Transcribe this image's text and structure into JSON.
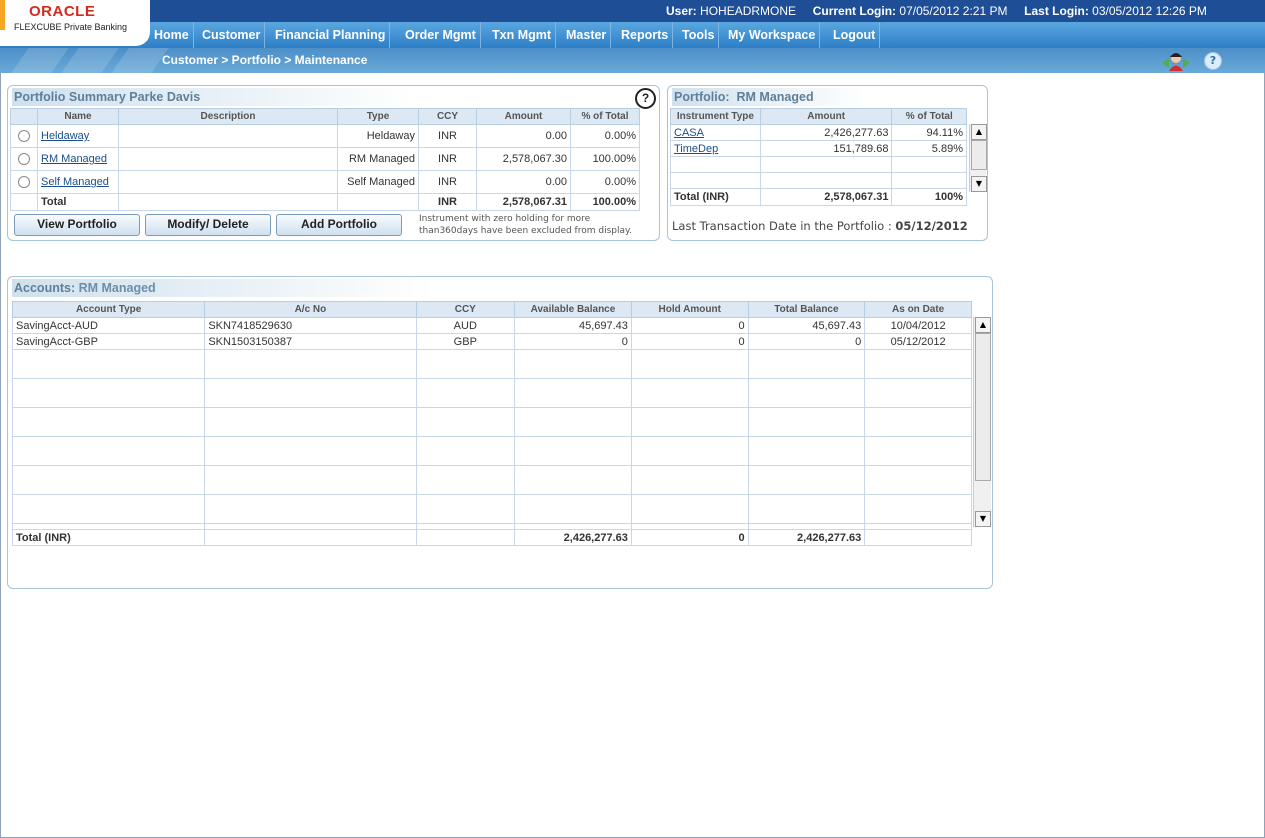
{
  "app": {
    "logo_brand": "ORACLE",
    "logo_product": "FLEXCUBE Private Banking"
  },
  "user_info": {
    "user_label": "User:",
    "user_value": "HOHEADRMONE",
    "current_login_label": "Current Login:",
    "current_login_value": "07/05/2012 2:21 PM",
    "last_login_label": "Last Login:",
    "last_login_value": "03/05/2012 12:26 PM"
  },
  "nav": [
    "Home",
    "Customer",
    "Financial Planning",
    "Order Mgmt",
    "Txn Mgmt",
    "Master",
    "Reports",
    "Tools",
    "My Workspace",
    "Logout"
  ],
  "breadcrumb": "Customer > Portfolio > Maintenance",
  "portfolio_summary": {
    "title": "Portfolio Summary Parke Davis",
    "headers": [
      "Name",
      "Description",
      "Type",
      "CCY",
      "Amount",
      "% of Total"
    ],
    "rows": [
      {
        "name": "Heldaway",
        "description": "",
        "type": "Heldaway",
        "ccy": "INR",
        "amount": "0.00",
        "pct": "0.00%"
      },
      {
        "name": "RM Managed",
        "description": "",
        "type": "RM Managed",
        "ccy": "INR",
        "amount": "2,578,067.30",
        "pct": "100.00%"
      },
      {
        "name": "Self Managed",
        "description": "",
        "type": "Self Managed",
        "ccy": "INR",
        "amount": "0.00",
        "pct": "0.00%"
      }
    ],
    "total": {
      "label": "Total",
      "ccy": "INR",
      "amount": "2,578,067.31",
      "pct": "100.00%"
    },
    "buttons": {
      "view": "View Portfolio",
      "modify": "Modify/ Delete",
      "add": "Add Portfolio"
    },
    "note_line1": "Instrument with zero holding for more",
    "note_line2": "than360days have been excluded from display."
  },
  "portfolio_rm": {
    "title_label": "Portfolio:",
    "title_value": "RM Managed",
    "headers": [
      "Instrument Type",
      "Amount",
      "% of Total"
    ],
    "rows": [
      {
        "type": "CASA",
        "amount": "2,426,277.63",
        "pct": "94.11%"
      },
      {
        "type": "TimeDep",
        "amount": "151,789.68",
        "pct": "5.89%"
      }
    ],
    "total": {
      "label": "Total (INR)",
      "amount": "2,578,067.31",
      "pct": "100%"
    },
    "last_txn_label": "Last Transaction Date in the Portfolio :",
    "last_txn_value": "05/12/2012"
  },
  "accounts": {
    "title_label": "Accounts:",
    "title_value": "RM Managed",
    "headers": [
      "Account Type",
      "A/c No",
      "CCY",
      "Available Balance",
      "Hold Amount",
      "Total Balance",
      "As on Date"
    ],
    "rows": [
      {
        "type": "SavingAcct-AUD",
        "acno": "SKN7418529630",
        "ccy": "AUD",
        "available": "45,697.43",
        "hold": "0",
        "total": "45,697.43",
        "date": "10/04/2012"
      },
      {
        "type": "SavingAcct-GBP",
        "acno": "SKN1503150387",
        "ccy": "GBP",
        "available": "0",
        "hold": "0",
        "total": "0",
        "date": "05/12/2012"
      }
    ],
    "total": {
      "label": "Total (INR)",
      "available": "2,426,277.63",
      "hold": "0",
      "total": "2,426,277.63"
    }
  },
  "colors": {
    "topbar": "#1d4e96",
    "nav": "#2d7ec7",
    "panel_title": "#5f7f99",
    "logo_red": "#d4291f"
  }
}
